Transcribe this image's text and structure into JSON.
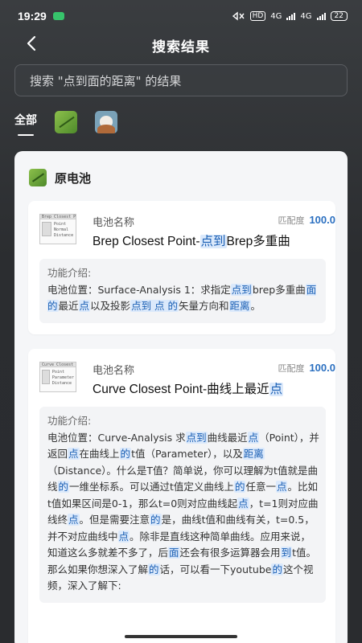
{
  "status": {
    "time": "19:29",
    "network_1": "4G",
    "network_2": "4G",
    "hd": "HD",
    "battery": "22"
  },
  "header": {
    "title": "搜索结果"
  },
  "search": {
    "text": "搜索 \"点到面的距离\" 的结果"
  },
  "tabs": {
    "all_label": "全部"
  },
  "section": {
    "title": "原电池"
  },
  "results": [
    {
      "name_label": "电池名称",
      "match_label": "匹配度",
      "match_value": "100.0",
      "thumb_title": "Brep Closest Point",
      "thumb_lines": [
        "Point",
        "Normal",
        "Distance"
      ],
      "name_parts": [
        "Brep Closest Point-",
        "点到",
        "Brep多重曲"
      ],
      "desc_label": "功能介绍:",
      "desc_parts": [
        "电池位置：Surface-Analysis 1：求指定",
        "点到",
        "brep多重曲",
        "面的",
        "最近",
        "点",
        "以及投影",
        "点到 点 的",
        "矢量方向和",
        "距离",
        "。"
      ]
    },
    {
      "name_label": "电池名称",
      "match_label": "匹配度",
      "match_value": "100.0",
      "thumb_title": "Curve Closest Point",
      "thumb_lines": [
        "Point",
        "Parameter",
        "Distance"
      ],
      "name_parts": [
        "Curve Closest Point-曲线上最近",
        "点"
      ],
      "desc_label": "功能介绍:",
      "desc_parts": [
        "电池位置：Curve-Analysis 求",
        "点到",
        "曲线最近",
        "点",
        "（Point），并返回",
        "点",
        "在曲线上",
        "的",
        "t值（Parameter），以及",
        "距离",
        "（Distance）。什么是T值？简单说，你可以理解为t值就是曲线",
        "的",
        "一维坐标系。可以通过t值定义曲线上",
        "的",
        "任意一",
        "点",
        "。比如t值如果区间是0-1，那么t=0则对应曲线起",
        "点",
        "，t=1则对应曲线终",
        "点",
        "。但是需要注意",
        "的",
        "是，曲线t值和曲线有关，t=0.5，并不对应曲线中",
        "点",
        "。除非是直线这种简单曲线。应用来说，知道这么多就差不多了，后",
        "面",
        "还会有很多运算器会用",
        "到",
        "t值。那么如果你想深入了解",
        "的",
        "话，可以看一下youtube",
        "的",
        "这个视频，深入了解下:"
      ]
    }
  ]
}
